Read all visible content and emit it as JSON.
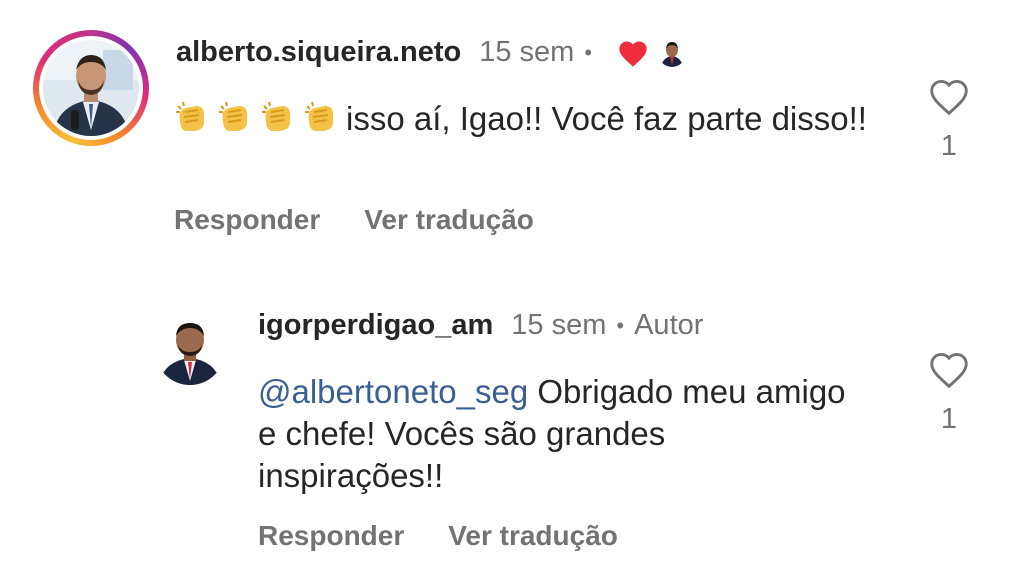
{
  "comments": [
    {
      "username": "alberto.siqueira.neto",
      "time": "15 sem",
      "separator": "•",
      "emojis": [
        "clap-icon",
        "clap-icon",
        "clap-icon",
        "clap-icon"
      ],
      "text": "isso aí, Igao!! Você faz parte disso!!",
      "reply_label": "Responder",
      "translate_label": "Ver tradução",
      "like_count": "1",
      "liked_by_author": true
    },
    {
      "username": "igorperdigao_am",
      "time": "15 sem",
      "separator": "•",
      "author_badge": "Autor",
      "mention": "@albertoneto_seg",
      "text": " Obrigado meu amigo e chefe! Vocês são grandes inspirações!!",
      "reply_label": "Responder",
      "translate_label": "Ver tradução",
      "like_count": "1"
    }
  ],
  "colors": {
    "text": "#262626",
    "muted": "#737373",
    "mention": "#3a5f93",
    "heart_red": "#ed2d3e"
  }
}
